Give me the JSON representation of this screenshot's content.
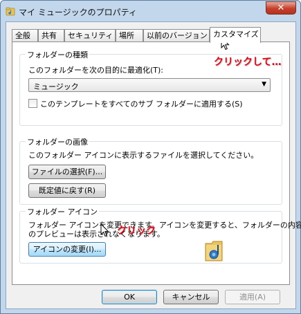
{
  "window": {
    "title": "マイ ミュージックのプロパティ",
    "close_glyph": "✕"
  },
  "tabs": [
    {
      "label": "全般",
      "selected": false
    },
    {
      "label": "共有",
      "selected": false
    },
    {
      "label": "セキュリティ",
      "selected": false
    },
    {
      "label": "場所",
      "selected": false
    },
    {
      "label": "以前のバージョン",
      "selected": false
    },
    {
      "label": "カスタマイズ",
      "selected": true
    }
  ],
  "optimize_group": {
    "title": "フォルダーの種類",
    "prompt": "このフォルダーを次の目的に最適化(T):",
    "selected_value": "ミュージック",
    "apply_subfolders_label": "このテンプレートをすべてのサブ フォルダーに適用する(S)",
    "apply_subfolders_checked": false
  },
  "picture_group": {
    "title": "フォルダーの画像",
    "description": "このフォルダー アイコンに表示するファイルを選択してください。",
    "choose_file_label": "ファイルの選択(F)...",
    "restore_default_label": "既定値に戻す(R)"
  },
  "icon_group": {
    "title": "フォルダー アイコン",
    "description_line1": "フォルダー アイコンを変更できます。アイコンを変更すると、フォルダーの内容",
    "description_line2": "のプレビューは表示されなくなります。",
    "change_icon_label": "アイコンの変更(I)..."
  },
  "footer": {
    "ok_label": "OK",
    "cancel_label": "キャンセル",
    "apply_label": "適用(A)"
  },
  "annotations": {
    "tab_hint": "クリックして…",
    "button_hint": "クリック"
  },
  "icons": [
    "music-folder-icon",
    "mouse-cursor-icon",
    "close-icon",
    "dropdown-arrow-icon"
  ],
  "colors": {
    "annotation": "#e8000e",
    "window_frame": "#c2d6ec",
    "close_button": "#c4402c"
  }
}
